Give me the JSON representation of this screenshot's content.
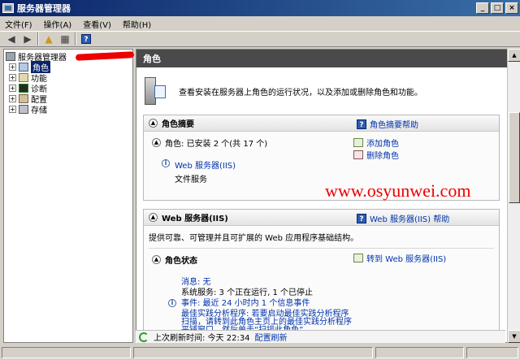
{
  "window": {
    "title": "服务器管理器"
  },
  "menu": [
    "文件(F)",
    "操作(A)",
    "查看(V)",
    "帮助(H)"
  ],
  "tree": {
    "root": "服务器管理器",
    "items": [
      "角色",
      "功能",
      "诊断",
      "配置",
      "存储"
    ]
  },
  "content": {
    "header": "角色",
    "intro": "查看安装在服务器上角色的运行状况，以及添加或删除角色和功能。",
    "summary": {
      "title": "角色摘要",
      "help": "角色摘要帮助",
      "roles_line": "角色: 已安装 2 个(共 17 个)",
      "installed": [
        "Web 服务器(IIS)",
        "文件服务"
      ],
      "add_role": "添加角色",
      "remove_role": "删除角色"
    },
    "web": {
      "title": "Web 服务器(IIS)",
      "help": "Web 服务器(IIS) 帮助",
      "desc": "提供可靠、可管理并且可扩展的 Web 应用程序基础结构。",
      "status_title": "角色状态",
      "goto": "转到 Web 服务器(IIS)",
      "messages": "消息: 无",
      "services": "系统服务: 3 个正在运行, 1 个已停止",
      "events": "事件: 最近 24 小时内 1 个信息事件",
      "bpa": [
        "最佳实践分析程序: 若要启动最佳实践分析程序",
        "扫描，请转到此角色主页上的最佳实践分析程序",
        "平铺窗口，然后单击“扫描此角色”"
      ]
    },
    "refresh": {
      "label": "上次刷新时间: 今天 22:34",
      "link": "配置刷新"
    }
  },
  "watermark": "www.osyunwei.com"
}
